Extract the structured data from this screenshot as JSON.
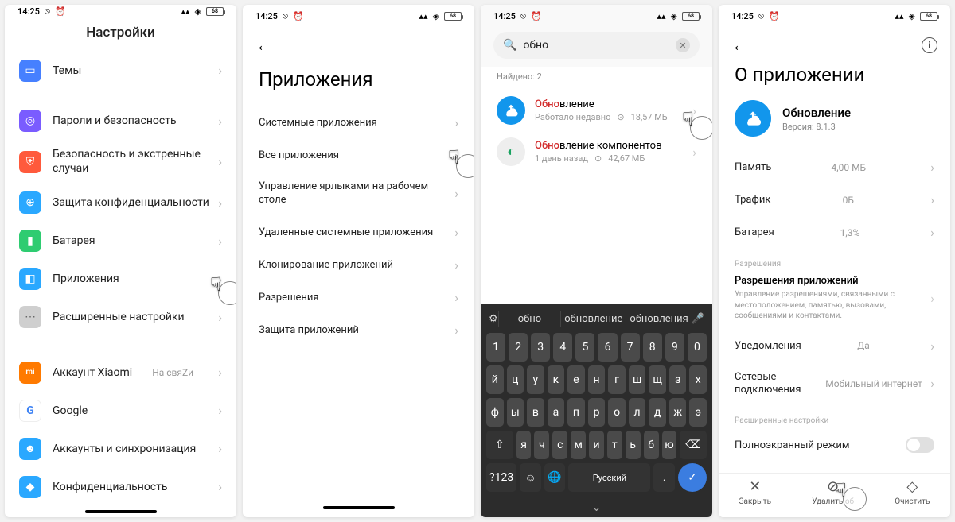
{
  "status": {
    "time": "14:25",
    "battery": "68"
  },
  "screen1": {
    "title": "Настройки",
    "items": [
      {
        "label": "Темы",
        "color": "#4680ff",
        "glyph": "▭"
      },
      {
        "label": "Пароли и безопасность",
        "color": "#7a5cff",
        "glyph": "◎"
      },
      {
        "label": "Безопасность и экстренные случаи",
        "color": "#ff5a3c",
        "glyph": "⛨"
      },
      {
        "label": "Защита конфиденциальности",
        "color": "#2aa8ff",
        "glyph": "⊕"
      },
      {
        "label": "Батарея",
        "color": "#2ecc71",
        "glyph": "▮"
      },
      {
        "label": "Приложения",
        "color": "#2aa8ff",
        "glyph": "◧"
      },
      {
        "label": "Расширенные настройки",
        "color": "#cfcfcf",
        "glyph": "⋯"
      }
    ],
    "items2": [
      {
        "label": "Аккаунт Xiaomi",
        "color": "#ff7a00",
        "glyph": "mi",
        "value": "На свяZи"
      },
      {
        "label": "Google",
        "color": "#ffffff",
        "glyph": "G"
      },
      {
        "label": "Аккаунты и синхронизация",
        "color": "#2aa8ff",
        "glyph": "☻"
      },
      {
        "label": "Конфиденциальность",
        "color": "#2aa8ff",
        "glyph": "◆"
      }
    ]
  },
  "screen2": {
    "title": "Приложения",
    "items": [
      "Системные приложения",
      "Все приложения",
      "Управление ярлыками на рабочем столе",
      "Удаленные системные приложения",
      "Клонирование приложений",
      "Разрешения",
      "Защита приложений"
    ]
  },
  "screen3": {
    "query": "обно",
    "found": "Найдено: 2",
    "results": [
      {
        "match": "Обно",
        "rest": "вление",
        "sub1": "Работало недавно",
        "size": "18,57 МБ",
        "blue": true
      },
      {
        "match": "Обно",
        "rest": "вление компонентов",
        "sub1": "1 день назад",
        "size": "42,67 МБ",
        "blue": false
      }
    ],
    "suggestions": [
      "обно",
      "обновление",
      "обновления"
    ],
    "kb_rows": {
      "r1": [
        "1",
        "2",
        "3",
        "4",
        "5",
        "6",
        "7",
        "8",
        "9",
        "0"
      ],
      "r2": [
        "й",
        "ц",
        "у",
        "к",
        "е",
        "н",
        "г",
        "ш",
        "щ",
        "з",
        "х"
      ],
      "r3": [
        "ф",
        "ы",
        "в",
        "а",
        "п",
        "р",
        "о",
        "л",
        "д",
        "ж",
        "э"
      ],
      "r4": [
        "я",
        "ч",
        "с",
        "м",
        "и",
        "т",
        "ь",
        "б",
        "ю"
      ]
    },
    "kb_lang": "Русский",
    "kb_numkey": "?123"
  },
  "screen4": {
    "title": "О приложении",
    "app": {
      "name": "Обновление",
      "version": "Версия: 8.1.3"
    },
    "stats": [
      {
        "label": "Память",
        "value": "4,00 МБ"
      },
      {
        "label": "Трафик",
        "value": "0Б"
      },
      {
        "label": "Батарея",
        "value": "1,3%"
      }
    ],
    "perm_section": "Разрешения",
    "perm_title": "Разрешения приложений",
    "perm_desc": "Управление разрешениями, связанными с местоположением, памятью, вызовами, сообщениями и контактами.",
    "notif": {
      "label": "Уведомления",
      "value": "Да"
    },
    "net": {
      "label": "Сетевые подключения",
      "value": "Мобильный интернет"
    },
    "adv_section": "Расширенные настройки",
    "fullscreen": "Полноэкранный режим",
    "actions": [
      {
        "label": "Закрыть",
        "glyph": "✕"
      },
      {
        "label": "Удалить об",
        "glyph": "⊘"
      },
      {
        "label": "Очистить",
        "glyph": "◇"
      }
    ]
  }
}
